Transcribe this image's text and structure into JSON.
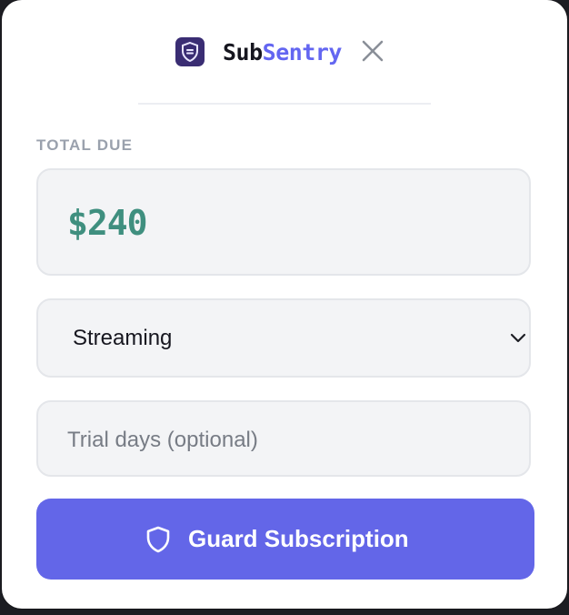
{
  "app": {
    "brand_part1": "Sub",
    "brand_part2": "Sentry",
    "accent_color": "#6366f1",
    "logo_icon": "shield-logo-icon",
    "close_icon": "close-icon"
  },
  "total": {
    "label": "TOTAL DUE",
    "amount": "$240",
    "amount_color": "#3f8f7f"
  },
  "category_select": {
    "selected": "Streaming",
    "icon": "chevron-down-icon"
  },
  "trial": {
    "placeholder": "Trial days (optional)",
    "value": ""
  },
  "submit": {
    "label": "Guard Subscription",
    "icon": "shield-icon",
    "color": "#6366e8"
  }
}
